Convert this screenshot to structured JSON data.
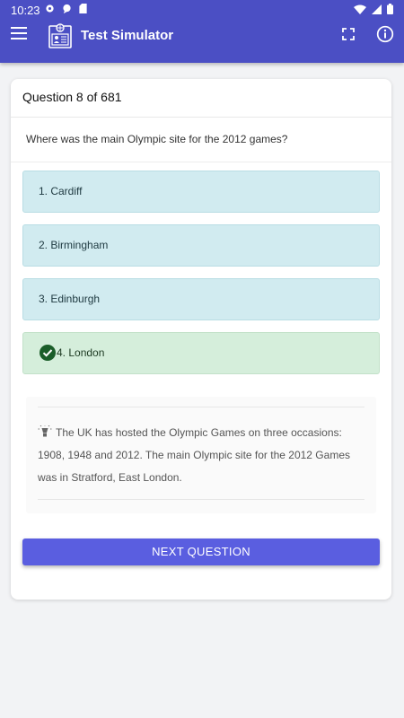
{
  "status_bar": {
    "time": "10:23"
  },
  "app": {
    "title": "Test Simulator"
  },
  "question": {
    "counter": "Question 8 of 681",
    "text": "Where was the main Olympic site for the 2012 games?"
  },
  "options": [
    {
      "label": "1. Cardiff",
      "state": "default"
    },
    {
      "label": "2. Birmingham",
      "state": "default"
    },
    {
      "label": "3. Edinburgh",
      "state": "default"
    },
    {
      "label": "4. London",
      "state": "correct"
    }
  ],
  "explanation": {
    "text": "The UK has hosted the Olympic Games on three occasions: 1908, 1948 and 2012. The main Olympic site for the 2012 Games was in Stratford, East London."
  },
  "next_button": {
    "label": "NEXT QUESTION"
  },
  "colors": {
    "appbar": "#4b4fc4",
    "option_default": "#d1ebf0",
    "option_correct": "#d5eedb",
    "check": "#1b5e2a",
    "button": "#5a5ee0"
  },
  "icons": [
    "gear-icon",
    "chat-bubble-icon",
    "sd-card-icon",
    "wifi-icon",
    "signal-icon",
    "battery-icon",
    "menu-icon",
    "app-logo-icon",
    "fullscreen-icon",
    "info-icon",
    "check-circle-icon",
    "lightbulb-icon"
  ]
}
